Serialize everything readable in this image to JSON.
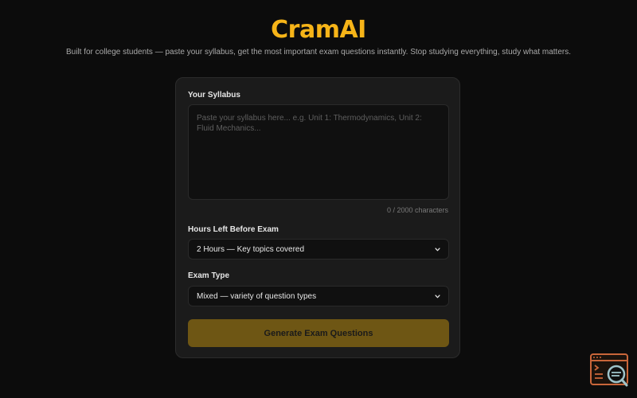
{
  "header": {
    "brand": "CramAI",
    "tagline": "Built for college students — paste your syllabus, get the most important exam questions instantly. Stop studying everything, study what matters."
  },
  "form": {
    "syllabus": {
      "label": "Your Syllabus",
      "placeholder": "Paste your syllabus here... e.g. Unit 1: Thermodynamics, Unit 2: Fluid Mechanics...",
      "value": "",
      "counter": "0 / 2000 characters"
    },
    "hours": {
      "label": "Hours Left Before Exam",
      "selected": "2 Hours — Key topics covered"
    },
    "exam_type": {
      "label": "Exam Type",
      "selected": "Mixed — variety of question types"
    },
    "submit_label": "Generate Exam Questions"
  },
  "colors": {
    "accent": "#f6b418",
    "button_bg": "#6e5614",
    "background": "#0c0c0c",
    "card": "#1b1b1b"
  },
  "icons": {
    "select_caret": "chevron-down-icon",
    "corner_widget": "terminal-search-icon"
  }
}
